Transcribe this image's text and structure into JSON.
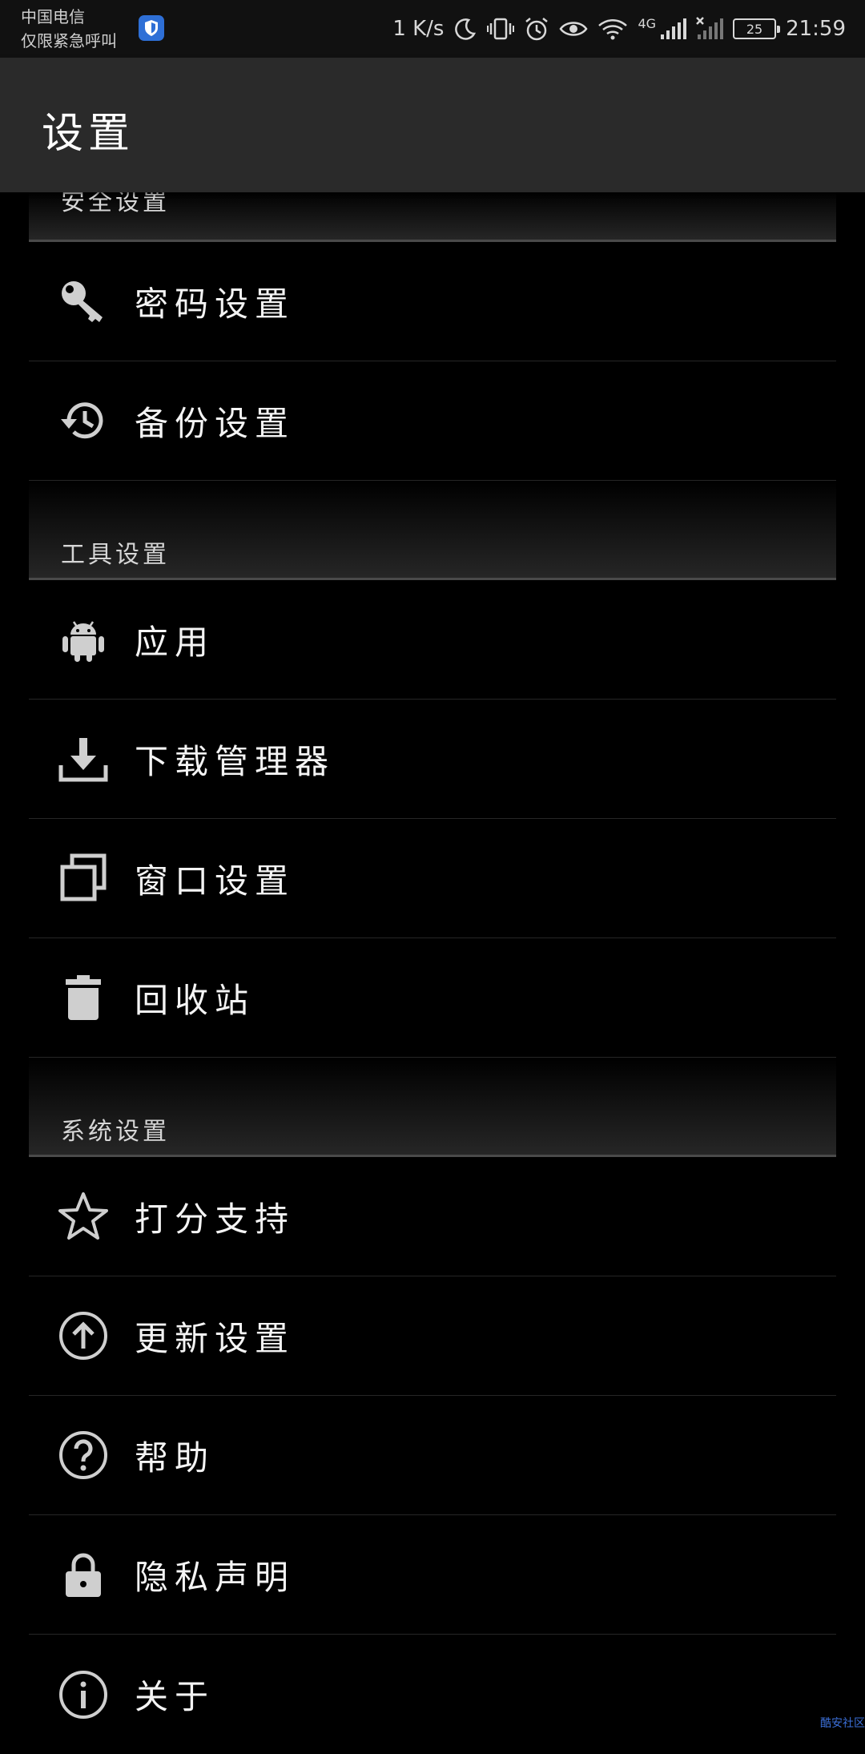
{
  "status_bar": {
    "carrier_line1": "中国电信",
    "carrier_line2": "仅限紧急呼叫",
    "net_speed": "1 K/s",
    "network_type": "4G",
    "battery_level": "25",
    "time": "21:59",
    "icons": [
      "shield-icon",
      "moon-icon",
      "vibrate-icon",
      "alarm-icon",
      "eye-icon",
      "wifi-icon",
      "signal-icon",
      "signal-off-icon",
      "battery-icon"
    ]
  },
  "app_bar": {
    "title": "设置"
  },
  "sections": [
    {
      "header": "安全设置",
      "items": [
        {
          "label": "密码设置",
          "icon": "key-icon"
        },
        {
          "label": "备份设置",
          "icon": "history-icon"
        }
      ]
    },
    {
      "header": "工具设置",
      "items": [
        {
          "label": "应用",
          "icon": "android-icon"
        },
        {
          "label": "下载管理器",
          "icon": "download-icon"
        },
        {
          "label": "窗口设置",
          "icon": "windows-icon"
        },
        {
          "label": "回收站",
          "icon": "trash-icon"
        }
      ]
    },
    {
      "header": "系统设置",
      "items": [
        {
          "label": "打分支持",
          "icon": "star-icon"
        },
        {
          "label": "更新设置",
          "icon": "arrow-up-circle-icon"
        },
        {
          "label": "帮助",
          "icon": "help-icon"
        },
        {
          "label": "隐私声明",
          "icon": "lock-icon"
        },
        {
          "label": "关于",
          "icon": "info-icon"
        }
      ]
    }
  ],
  "watermark": "酷安社区"
}
